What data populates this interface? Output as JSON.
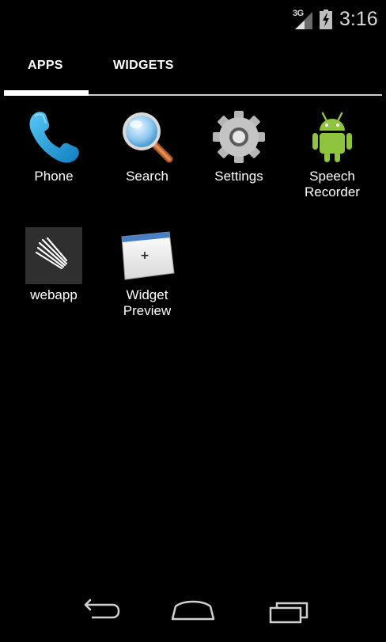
{
  "status_bar": {
    "network": "3G",
    "time": "3:16"
  },
  "tabs": [
    {
      "label": "APPS",
      "selected": true
    },
    {
      "label": "WIDGETS",
      "selected": false
    }
  ],
  "apps": [
    {
      "label": "Phone",
      "icon": "phone-icon"
    },
    {
      "label": "Search",
      "icon": "search-icon"
    },
    {
      "label": "Settings",
      "icon": "gear-icon"
    },
    {
      "label": "Speech\nRecorder",
      "icon": "android-icon"
    },
    {
      "label": "webapp",
      "icon": "webapp-icon"
    },
    {
      "label": "Widget\nPreview",
      "icon": "widget-preview-icon"
    }
  ],
  "navigation": {
    "back": "back-icon",
    "home": "home-icon",
    "recents": "recent-apps-icon"
  },
  "colors": {
    "background": "#000000",
    "tab_indicator": "#ffffff",
    "phone_blue": "#1e9ad6",
    "android_green": "#8fc43e"
  }
}
